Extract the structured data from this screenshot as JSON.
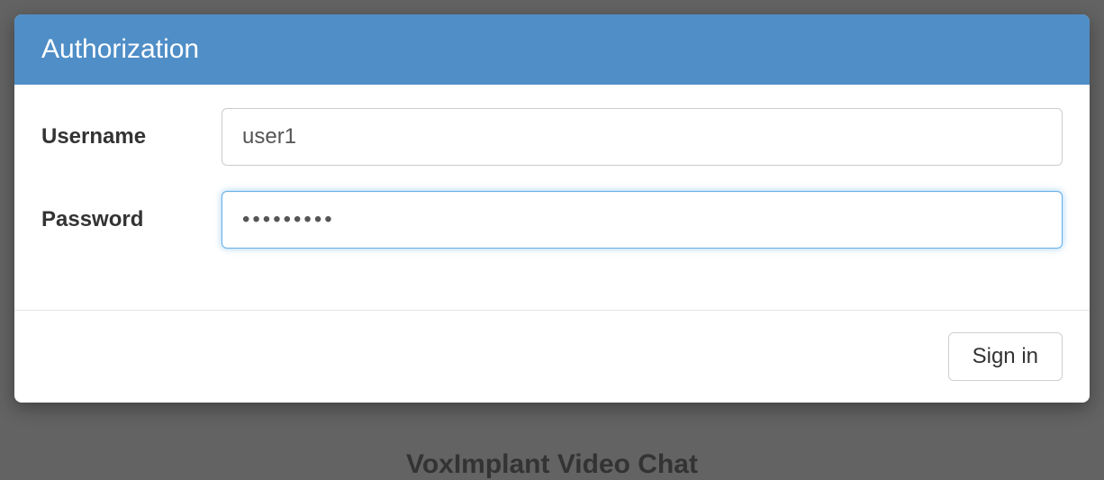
{
  "background": {
    "title": "VoxImplant Video Chat"
  },
  "modal": {
    "title": "Authorization",
    "form": {
      "username": {
        "label": "Username",
        "value": "user1"
      },
      "password": {
        "label": "Password",
        "value": "•••••••••"
      }
    },
    "footer": {
      "submit": "Sign in"
    }
  },
  "colors": {
    "header_bg": "#4f8ec7",
    "focus_border": "#66afe9"
  }
}
